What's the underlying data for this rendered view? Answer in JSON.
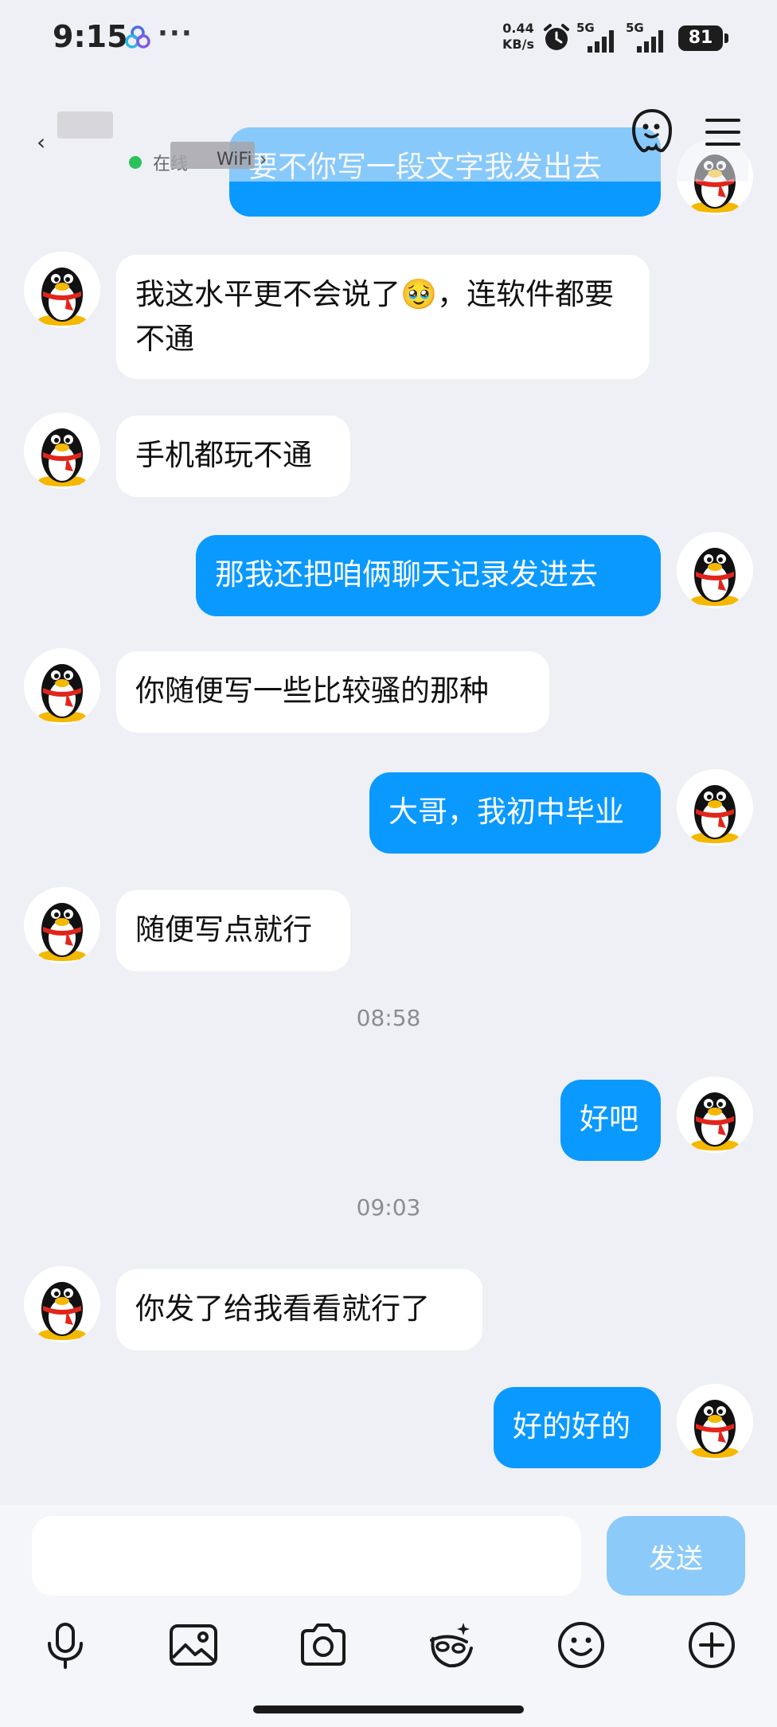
{
  "status_bar": {
    "time": "9:15",
    "more": "···",
    "speed_value": "0.44",
    "speed_unit": "KB/s",
    "signal1_label": "5G",
    "signal2_label": "5G",
    "battery": "81"
  },
  "header": {
    "back": "‹",
    "status_text": "在线",
    "network_text": "WiFi",
    "chevron": "›",
    "icons": [
      "ai-assistant-icon",
      "menu-icon"
    ]
  },
  "messages": [
    {
      "side": "out",
      "text": "要不你写一段文字我发出去"
    },
    {
      "side": "in",
      "text": "我这水平更不会说了🥹，连软件都要不通"
    },
    {
      "side": "in",
      "text": "手机都玩不通"
    },
    {
      "side": "out",
      "text": "那我还把咱俩聊天记录发进去"
    },
    {
      "side": "in",
      "text": "你随便写一些比较骚的那种"
    },
    {
      "side": "out",
      "text": "大哥，我初中毕业"
    },
    {
      "side": "in",
      "text": "随便写点就行"
    },
    {
      "side": "out",
      "text": "好吧"
    },
    {
      "side": "in",
      "text": "你发了给我看看就行了"
    },
    {
      "side": "out",
      "text": "好的好的"
    }
  ],
  "timestamps": [
    "08:58",
    "09:03"
  ],
  "input": {
    "value": "",
    "placeholder": "",
    "send_label": "发送"
  },
  "toolbar": [
    "microphone-icon",
    "image-icon",
    "camera-icon",
    "sticker-icon",
    "emoji-icon",
    "plus-icon"
  ],
  "colors": {
    "background": "#eef0f5",
    "outgoing_bubble": "#0a99ff",
    "incoming_bubble": "#ffffff",
    "send_button": "#8ccaf9",
    "online_dot": "#2ac259"
  }
}
